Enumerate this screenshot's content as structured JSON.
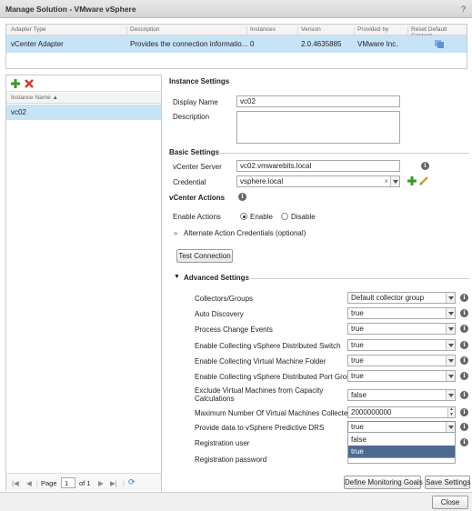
{
  "window": {
    "title": "Manage Solution - VMware vSphere",
    "help": "?"
  },
  "adapters": {
    "headers": [
      "Adapter Type",
      "Description",
      "Instances",
      "Version",
      "Provided by",
      "Reset Default Content"
    ],
    "row": [
      "vCenter Adapter",
      "Provides the connection informatio...",
      "0",
      "2.0.4635885",
      "VMware Inc."
    ]
  },
  "instances": {
    "header": "Instance Name ▲",
    "items": [
      "vc02"
    ],
    "pager": {
      "page_label": "Page",
      "page_value": "1",
      "of_label": "of 1"
    }
  },
  "instance_settings": {
    "title": "Instance Settings",
    "display_name_label": "Display Name",
    "display_name_value": "vc02",
    "description_label": "Description",
    "description_value": ""
  },
  "basic": {
    "title": "Basic Settings",
    "server_label": "vCenter Server",
    "server_value": "vc02.vmwarebits.local",
    "credential_label": "Credential",
    "credential_value": "vsphere.local"
  },
  "actions": {
    "title": "vCenter Actions",
    "enable_label": "Enable Actions",
    "enable_option": "Enable",
    "disable_option": "Disable",
    "selected": "Enable",
    "alternate_label": "Alternate Action Credentials (optional)"
  },
  "test_button": "Test Connection",
  "advanced": {
    "title": "Advanced Settings",
    "rows": [
      {
        "label": "Collectors/Groups",
        "value": "Default collector group"
      },
      {
        "label": "Auto Discovery",
        "value": "true"
      },
      {
        "label": "Process Change Events",
        "value": "true"
      },
      {
        "label": "Enable Collecting vSphere Distributed Switch",
        "value": "true"
      },
      {
        "label": "Enable Collecting Virtual Machine Folder",
        "value": "true"
      },
      {
        "label": "Enable Collecting vSphere Distributed Port Group",
        "value": "true"
      },
      {
        "label": "Exclude Virtual Machines from Capacity",
        "label2": "Calculations",
        "value": "false"
      },
      {
        "label": "Maximum Number Of Virtual Machines Collected",
        "value": "2000000000"
      },
      {
        "label": "Provide data to vSphere Predictive DRS",
        "value": "true"
      }
    ],
    "dropdown_options": [
      "false",
      "true"
    ],
    "registration_user_label": "Registration user",
    "registration_password_label": "Registration password"
  },
  "buttons": {
    "define_goals": "Define Monitoring Goals",
    "save": "Save Settings",
    "close": "Close"
  },
  "colors": {
    "selection": "#c7e3f8",
    "add_icon": "#3a9a2a",
    "delete_icon": "#d23a2a",
    "dropdown_highlight": "#4f6a8f"
  }
}
